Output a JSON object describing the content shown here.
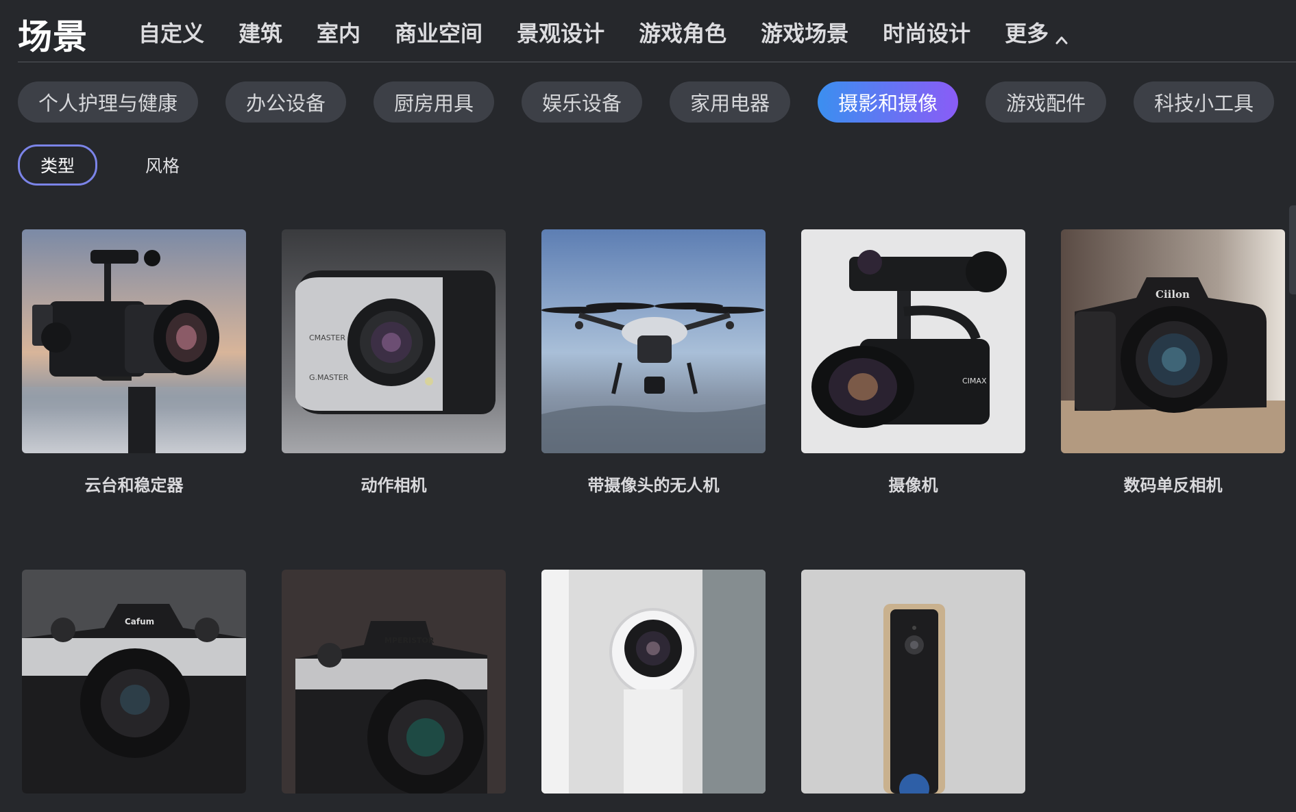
{
  "header": {
    "brand": "场景",
    "nav": [
      "自定义",
      "建筑",
      "室内",
      "商业空间",
      "景观设计",
      "游戏角色",
      "游戏场景",
      "时尚设计"
    ],
    "more": "更多"
  },
  "categories": {
    "items": [
      "个人护理与健康",
      "办公设备",
      "厨房用具",
      "娱乐设备",
      "家用电器",
      "摄影和摄像",
      "游戏配件",
      "科技小工具"
    ],
    "active": "摄影和摄像"
  },
  "filters": {
    "type": "类型",
    "style": "风格"
  },
  "cards": [
    {
      "title": "云台和稳定器"
    },
    {
      "title": "动作相机"
    },
    {
      "title": "带摄像头的无人机"
    },
    {
      "title": "摄像机"
    },
    {
      "title": "数码单反相机"
    },
    {
      "title": ""
    },
    {
      "title": ""
    },
    {
      "title": ""
    },
    {
      "title": ""
    }
  ],
  "image_labels": {
    "action_cam": "CMASTER",
    "action_cam_2": "G.MASTER",
    "camcorder": "CIMAX",
    "dslr": "Ciilon",
    "film_cam_1": "Cafum",
    "film_cam_2": "MPERISTOR"
  }
}
